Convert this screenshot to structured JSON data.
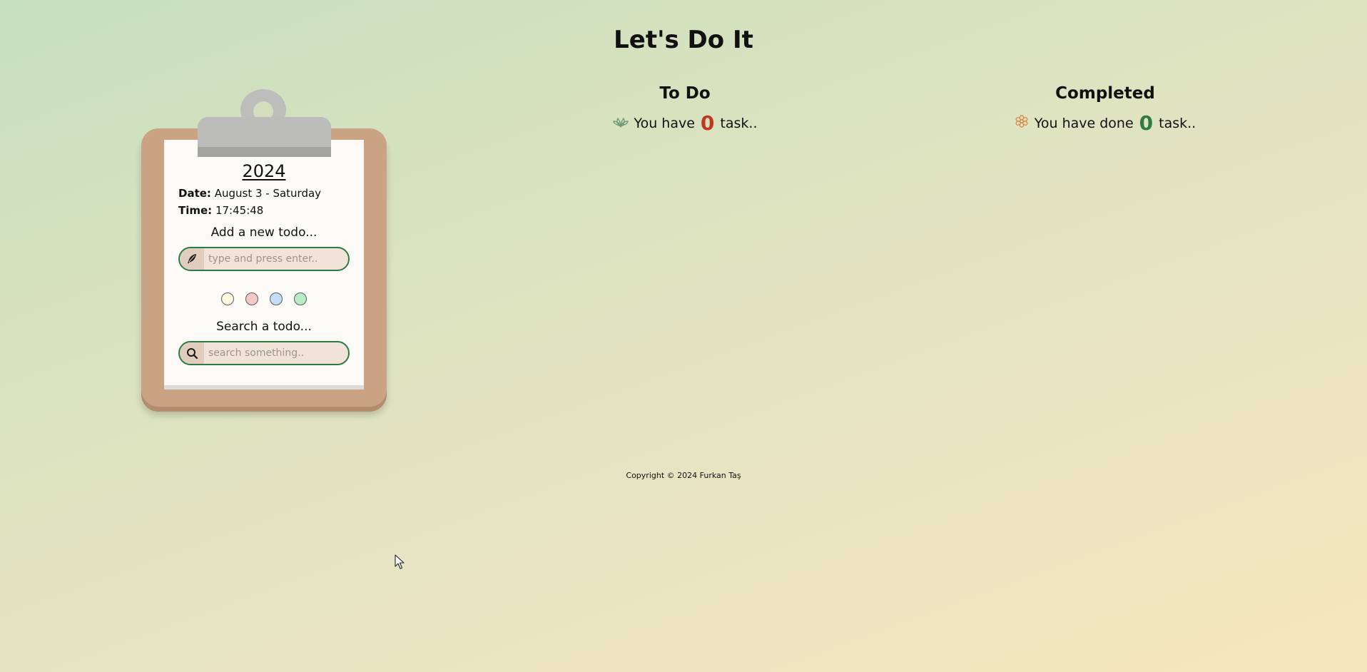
{
  "header": {
    "title": "Let's Do It"
  },
  "clipboard": {
    "year": "2024",
    "date_label": "Date:",
    "date_value": "August 3 - Saturday",
    "time_label": "Time:",
    "time_value": "17:45:48",
    "add_heading": "Add a new todo...",
    "add_input": {
      "value": "",
      "placeholder": "type and press enter..",
      "icon": "feather-icon"
    },
    "color_options": [
      {
        "name": "yellow",
        "color": "#fbf8dc"
      },
      {
        "name": "pink",
        "color": "#f2c8c6"
      },
      {
        "name": "blue",
        "color": "#c4dff5"
      },
      {
        "name": "green",
        "color": "#b8ecc5"
      }
    ],
    "search_heading": "Search a todo...",
    "search_input": {
      "value": "",
      "placeholder": "search something..",
      "icon": "search-icon"
    }
  },
  "todo": {
    "title": "To Do",
    "prefix": "You have",
    "count": "0",
    "suffix": "task..",
    "icon": "leaf-icon",
    "count_color": "#c0391e"
  },
  "completed": {
    "title": "Completed",
    "prefix": "You have done",
    "count": "0",
    "suffix": "task..",
    "icon": "flower-icon",
    "count_color": "#2d7a45"
  },
  "footer": {
    "copyright": "Copyright © 2024 Furkan Taş"
  }
}
